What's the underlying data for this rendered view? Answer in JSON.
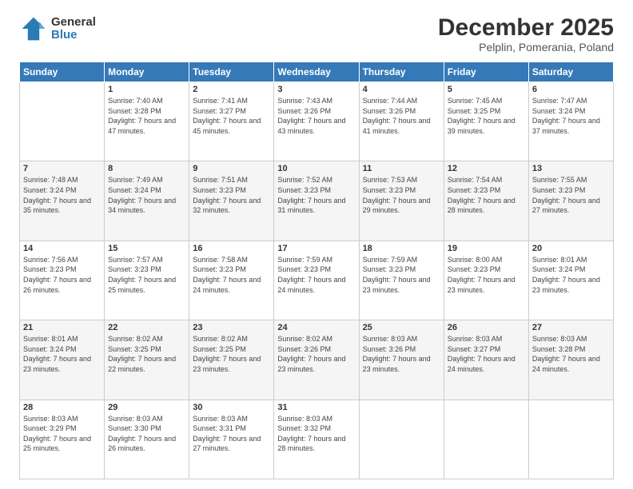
{
  "logo": {
    "general": "General",
    "blue": "Blue"
  },
  "header": {
    "title": "December 2025",
    "subtitle": "Pelplin, Pomerania, Poland"
  },
  "weekdays": [
    "Sunday",
    "Monday",
    "Tuesday",
    "Wednesday",
    "Thursday",
    "Friday",
    "Saturday"
  ],
  "weeks": [
    [
      {
        "day": "",
        "sunrise": "",
        "sunset": "",
        "daylight": ""
      },
      {
        "day": "1",
        "sunrise": "Sunrise: 7:40 AM",
        "sunset": "Sunset: 3:28 PM",
        "daylight": "Daylight: 7 hours and 47 minutes."
      },
      {
        "day": "2",
        "sunrise": "Sunrise: 7:41 AM",
        "sunset": "Sunset: 3:27 PM",
        "daylight": "Daylight: 7 hours and 45 minutes."
      },
      {
        "day": "3",
        "sunrise": "Sunrise: 7:43 AM",
        "sunset": "Sunset: 3:26 PM",
        "daylight": "Daylight: 7 hours and 43 minutes."
      },
      {
        "day": "4",
        "sunrise": "Sunrise: 7:44 AM",
        "sunset": "Sunset: 3:26 PM",
        "daylight": "Daylight: 7 hours and 41 minutes."
      },
      {
        "day": "5",
        "sunrise": "Sunrise: 7:45 AM",
        "sunset": "Sunset: 3:25 PM",
        "daylight": "Daylight: 7 hours and 39 minutes."
      },
      {
        "day": "6",
        "sunrise": "Sunrise: 7:47 AM",
        "sunset": "Sunset: 3:24 PM",
        "daylight": "Daylight: 7 hours and 37 minutes."
      }
    ],
    [
      {
        "day": "7",
        "sunrise": "Sunrise: 7:48 AM",
        "sunset": "Sunset: 3:24 PM",
        "daylight": "Daylight: 7 hours and 35 minutes."
      },
      {
        "day": "8",
        "sunrise": "Sunrise: 7:49 AM",
        "sunset": "Sunset: 3:24 PM",
        "daylight": "Daylight: 7 hours and 34 minutes."
      },
      {
        "day": "9",
        "sunrise": "Sunrise: 7:51 AM",
        "sunset": "Sunset: 3:23 PM",
        "daylight": "Daylight: 7 hours and 32 minutes."
      },
      {
        "day": "10",
        "sunrise": "Sunrise: 7:52 AM",
        "sunset": "Sunset: 3:23 PM",
        "daylight": "Daylight: 7 hours and 31 minutes."
      },
      {
        "day": "11",
        "sunrise": "Sunrise: 7:53 AM",
        "sunset": "Sunset: 3:23 PM",
        "daylight": "Daylight: 7 hours and 29 minutes."
      },
      {
        "day": "12",
        "sunrise": "Sunrise: 7:54 AM",
        "sunset": "Sunset: 3:23 PM",
        "daylight": "Daylight: 7 hours and 28 minutes."
      },
      {
        "day": "13",
        "sunrise": "Sunrise: 7:55 AM",
        "sunset": "Sunset: 3:23 PM",
        "daylight": "Daylight: 7 hours and 27 minutes."
      }
    ],
    [
      {
        "day": "14",
        "sunrise": "Sunrise: 7:56 AM",
        "sunset": "Sunset: 3:23 PM",
        "daylight": "Daylight: 7 hours and 26 minutes."
      },
      {
        "day": "15",
        "sunrise": "Sunrise: 7:57 AM",
        "sunset": "Sunset: 3:23 PM",
        "daylight": "Daylight: 7 hours and 25 minutes."
      },
      {
        "day": "16",
        "sunrise": "Sunrise: 7:58 AM",
        "sunset": "Sunset: 3:23 PM",
        "daylight": "Daylight: 7 hours and 24 minutes."
      },
      {
        "day": "17",
        "sunrise": "Sunrise: 7:59 AM",
        "sunset": "Sunset: 3:23 PM",
        "daylight": "Daylight: 7 hours and 24 minutes."
      },
      {
        "day": "18",
        "sunrise": "Sunrise: 7:59 AM",
        "sunset": "Sunset: 3:23 PM",
        "daylight": "Daylight: 7 hours and 23 minutes."
      },
      {
        "day": "19",
        "sunrise": "Sunrise: 8:00 AM",
        "sunset": "Sunset: 3:23 PM",
        "daylight": "Daylight: 7 hours and 23 minutes."
      },
      {
        "day": "20",
        "sunrise": "Sunrise: 8:01 AM",
        "sunset": "Sunset: 3:24 PM",
        "daylight": "Daylight: 7 hours and 23 minutes."
      }
    ],
    [
      {
        "day": "21",
        "sunrise": "Sunrise: 8:01 AM",
        "sunset": "Sunset: 3:24 PM",
        "daylight": "Daylight: 7 hours and 23 minutes."
      },
      {
        "day": "22",
        "sunrise": "Sunrise: 8:02 AM",
        "sunset": "Sunset: 3:25 PM",
        "daylight": "Daylight: 7 hours and 22 minutes."
      },
      {
        "day": "23",
        "sunrise": "Sunrise: 8:02 AM",
        "sunset": "Sunset: 3:25 PM",
        "daylight": "Daylight: 7 hours and 23 minutes."
      },
      {
        "day": "24",
        "sunrise": "Sunrise: 8:02 AM",
        "sunset": "Sunset: 3:26 PM",
        "daylight": "Daylight: 7 hours and 23 minutes."
      },
      {
        "day": "25",
        "sunrise": "Sunrise: 8:03 AM",
        "sunset": "Sunset: 3:26 PM",
        "daylight": "Daylight: 7 hours and 23 minutes."
      },
      {
        "day": "26",
        "sunrise": "Sunrise: 8:03 AM",
        "sunset": "Sunset: 3:27 PM",
        "daylight": "Daylight: 7 hours and 24 minutes."
      },
      {
        "day": "27",
        "sunrise": "Sunrise: 8:03 AM",
        "sunset": "Sunset: 3:28 PM",
        "daylight": "Daylight: 7 hours and 24 minutes."
      }
    ],
    [
      {
        "day": "28",
        "sunrise": "Sunrise: 8:03 AM",
        "sunset": "Sunset: 3:29 PM",
        "daylight": "Daylight: 7 hours and 25 minutes."
      },
      {
        "day": "29",
        "sunrise": "Sunrise: 8:03 AM",
        "sunset": "Sunset: 3:30 PM",
        "daylight": "Daylight: 7 hours and 26 minutes."
      },
      {
        "day": "30",
        "sunrise": "Sunrise: 8:03 AM",
        "sunset": "Sunset: 3:31 PM",
        "daylight": "Daylight: 7 hours and 27 minutes."
      },
      {
        "day": "31",
        "sunrise": "Sunrise: 8:03 AM",
        "sunset": "Sunset: 3:32 PM",
        "daylight": "Daylight: 7 hours and 28 minutes."
      },
      {
        "day": "",
        "sunrise": "",
        "sunset": "",
        "daylight": ""
      },
      {
        "day": "",
        "sunrise": "",
        "sunset": "",
        "daylight": ""
      },
      {
        "day": "",
        "sunrise": "",
        "sunset": "",
        "daylight": ""
      }
    ]
  ]
}
